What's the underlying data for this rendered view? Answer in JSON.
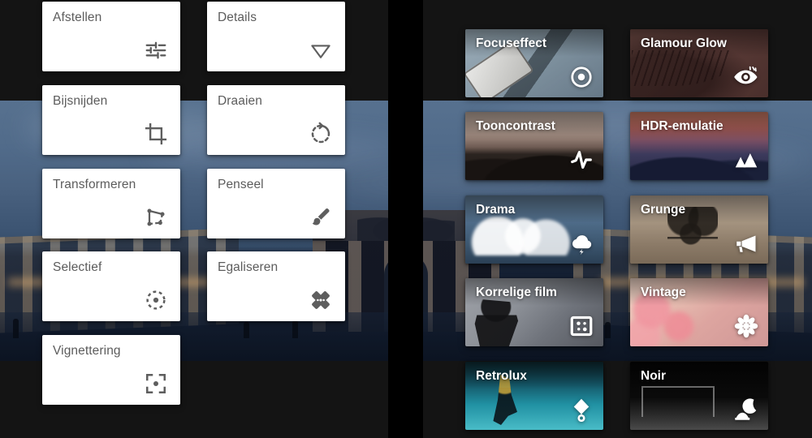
{
  "app": {
    "background_photo": "brandenburg-gate-dusk",
    "left_pane_title": "Tools",
    "right_pane_title": "Filters"
  },
  "tools": {
    "items": [
      {
        "label": "Afstellen",
        "icon": "tune-sliders-icon",
        "col": 0,
        "row": 0
      },
      {
        "label": "Details",
        "icon": "triangle-down-icon",
        "col": 1,
        "row": 0
      },
      {
        "label": "Bijsnijden",
        "icon": "crop-icon",
        "col": 0,
        "row": 1
      },
      {
        "label": "Draaien",
        "icon": "rotate-icon",
        "col": 1,
        "row": 1
      },
      {
        "label": "Transformeren",
        "icon": "transform-nodes-icon",
        "col": 0,
        "row": 2
      },
      {
        "label": "Penseel",
        "icon": "paintbrush-icon",
        "col": 1,
        "row": 2
      },
      {
        "label": "Selectief",
        "icon": "selective-dot-icon",
        "col": 0,
        "row": 3
      },
      {
        "label": "Egaliseren",
        "icon": "healing-patch-icon",
        "col": 1,
        "row": 3
      },
      {
        "label": "Vignettering",
        "icon": "vignette-frame-icon",
        "col": 0,
        "row": 4
      }
    ]
  },
  "filters": {
    "items": [
      {
        "label": "Focuseffect",
        "icon": "focus-target-icon",
        "thumb": "th-focus",
        "col": 0,
        "row": 0
      },
      {
        "label": "Glamour Glow",
        "icon": "eye-glow-icon",
        "thumb": "th-glam",
        "col": 1,
        "row": 0
      },
      {
        "label": "Tooncontrast",
        "icon": "pulse-wave-icon",
        "thumb": "th-tone",
        "col": 0,
        "row": 1
      },
      {
        "label": "HDR-emulatie",
        "icon": "mountains-icon",
        "thumb": "th-hdr",
        "col": 1,
        "row": 1
      },
      {
        "label": "Drama",
        "icon": "storm-cloud-icon",
        "thumb": "th-drama",
        "col": 0,
        "row": 2
      },
      {
        "label": "Grunge",
        "icon": "megaphone-icon",
        "thumb": "th-grunge",
        "col": 1,
        "row": 2
      },
      {
        "label": "Korrelige film",
        "icon": "grain-square-icon",
        "thumb": "th-korrel",
        "col": 0,
        "row": 3
      },
      {
        "label": "Vintage",
        "icon": "flower-icon",
        "thumb": "th-vintage",
        "col": 1,
        "row": 3
      },
      {
        "label": "Retrolux",
        "icon": "balloon-icon",
        "thumb": "th-retro",
        "col": 0,
        "row": 4
      },
      {
        "label": "Noir",
        "icon": "moon-icon",
        "thumb": "th-noir",
        "col": 1,
        "row": 4
      }
    ]
  },
  "colors": {
    "card_background": "#ffffff",
    "card_text": "#5c5c5c",
    "filter_text": "#ffffff",
    "pane_background": "#141414",
    "divider": "#000000",
    "photo_sky": "#4a6280"
  }
}
